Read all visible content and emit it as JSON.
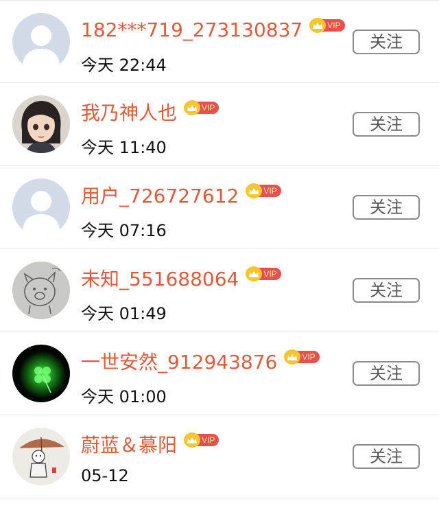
{
  "follow_label": "关注",
  "vip_label": "VIP",
  "colors": {
    "username": "#e05a3a",
    "vip_badge": "#e8504f",
    "crown": "#f7c62f",
    "divider": "#e6e6e6"
  },
  "users": [
    {
      "name": "182***719_273130837",
      "time": "今天 22:44",
      "avatar": "default-avatar"
    },
    {
      "name": "我乃神人也",
      "time": "今天 11:40",
      "avatar": "girl-avatar"
    },
    {
      "name": "用户_726727612",
      "time": "今天 07:16",
      "avatar": "default-avatar"
    },
    {
      "name": "未知_551688064",
      "time": "今天 01:49",
      "avatar": "sketch-pig-avatar"
    },
    {
      "name": "一世安然_912943876",
      "time": "今天 01:00",
      "avatar": "green-clover-avatar"
    },
    {
      "name": "蔚蓝＆慕阳",
      "time": "05-12",
      "avatar": "cartoon-umbrella-avatar"
    }
  ]
}
